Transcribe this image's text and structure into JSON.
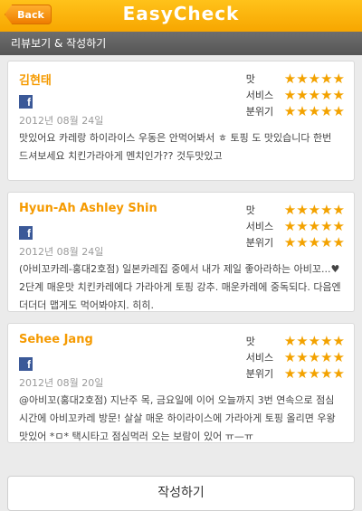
{
  "header": {
    "back_label": "Back",
    "title": "EasyCheck"
  },
  "subbar": {
    "label": "리뷰보기 & 작성하기"
  },
  "rating_labels": {
    "taste": "맛",
    "service": "서비스",
    "atmosphere": "분위기"
  },
  "reviews": [
    {
      "name": "김현태",
      "date": "2012년 08월 24일",
      "text": "맛있어요 카레랑 하이라이스 우동은 안먹어봐서 ㅎ 토핑 도 맛있습니다 한번 드셔보세요 치킨가라아게 멘치인가?? 것두맛있고",
      "stars": {
        "taste": "★★★★★",
        "service": "★★★★★",
        "atmosphere": "★★★★★"
      },
      "icon": "facebook-icon"
    },
    {
      "name": "Hyun-Ah Ashley Shin",
      "date": "2012년 08월 24일",
      "text": "(아비꼬카레-홍대2호점) 일본카레집 중에서 내가 제일 좋아라하는 아비꼬...♥ 2단계 매운맛 치킨카레에다 가라아게 토핑 강추. 매운카레에 중독되다. 다음엔 더더더 맵게도 먹어봐야지. 히히.",
      "stars": {
        "taste": "★★★★★",
        "service": "★★★★★",
        "atmosphere": "★★★★★"
      },
      "icon": "facebook-icon"
    },
    {
      "name": "Sehee Jang",
      "date": "2012년 08월 20일",
      "text": "@아비꼬(홍대2호점) 지난주 목, 금요일에 이어 오늘까지 3번 연속으로 점심시간에 아비꼬카레 방문! 살살 매운 하이라이스에 가라아게 토핑 올리면 우왕 맛있어 *ㅁ* 택시타고 점심먹러 오는 보람이 있어 ㅠ—ㅠ",
      "stars": {
        "taste": "★★★★★",
        "service": "★★★★★",
        "atmosphere": "★★★★★"
      },
      "icon": "facebook-icon"
    }
  ],
  "footer": {
    "write_label": "작성하기"
  },
  "colors": {
    "accent": "#f7a600",
    "name": "#f59a00",
    "star": "#f3a200"
  }
}
